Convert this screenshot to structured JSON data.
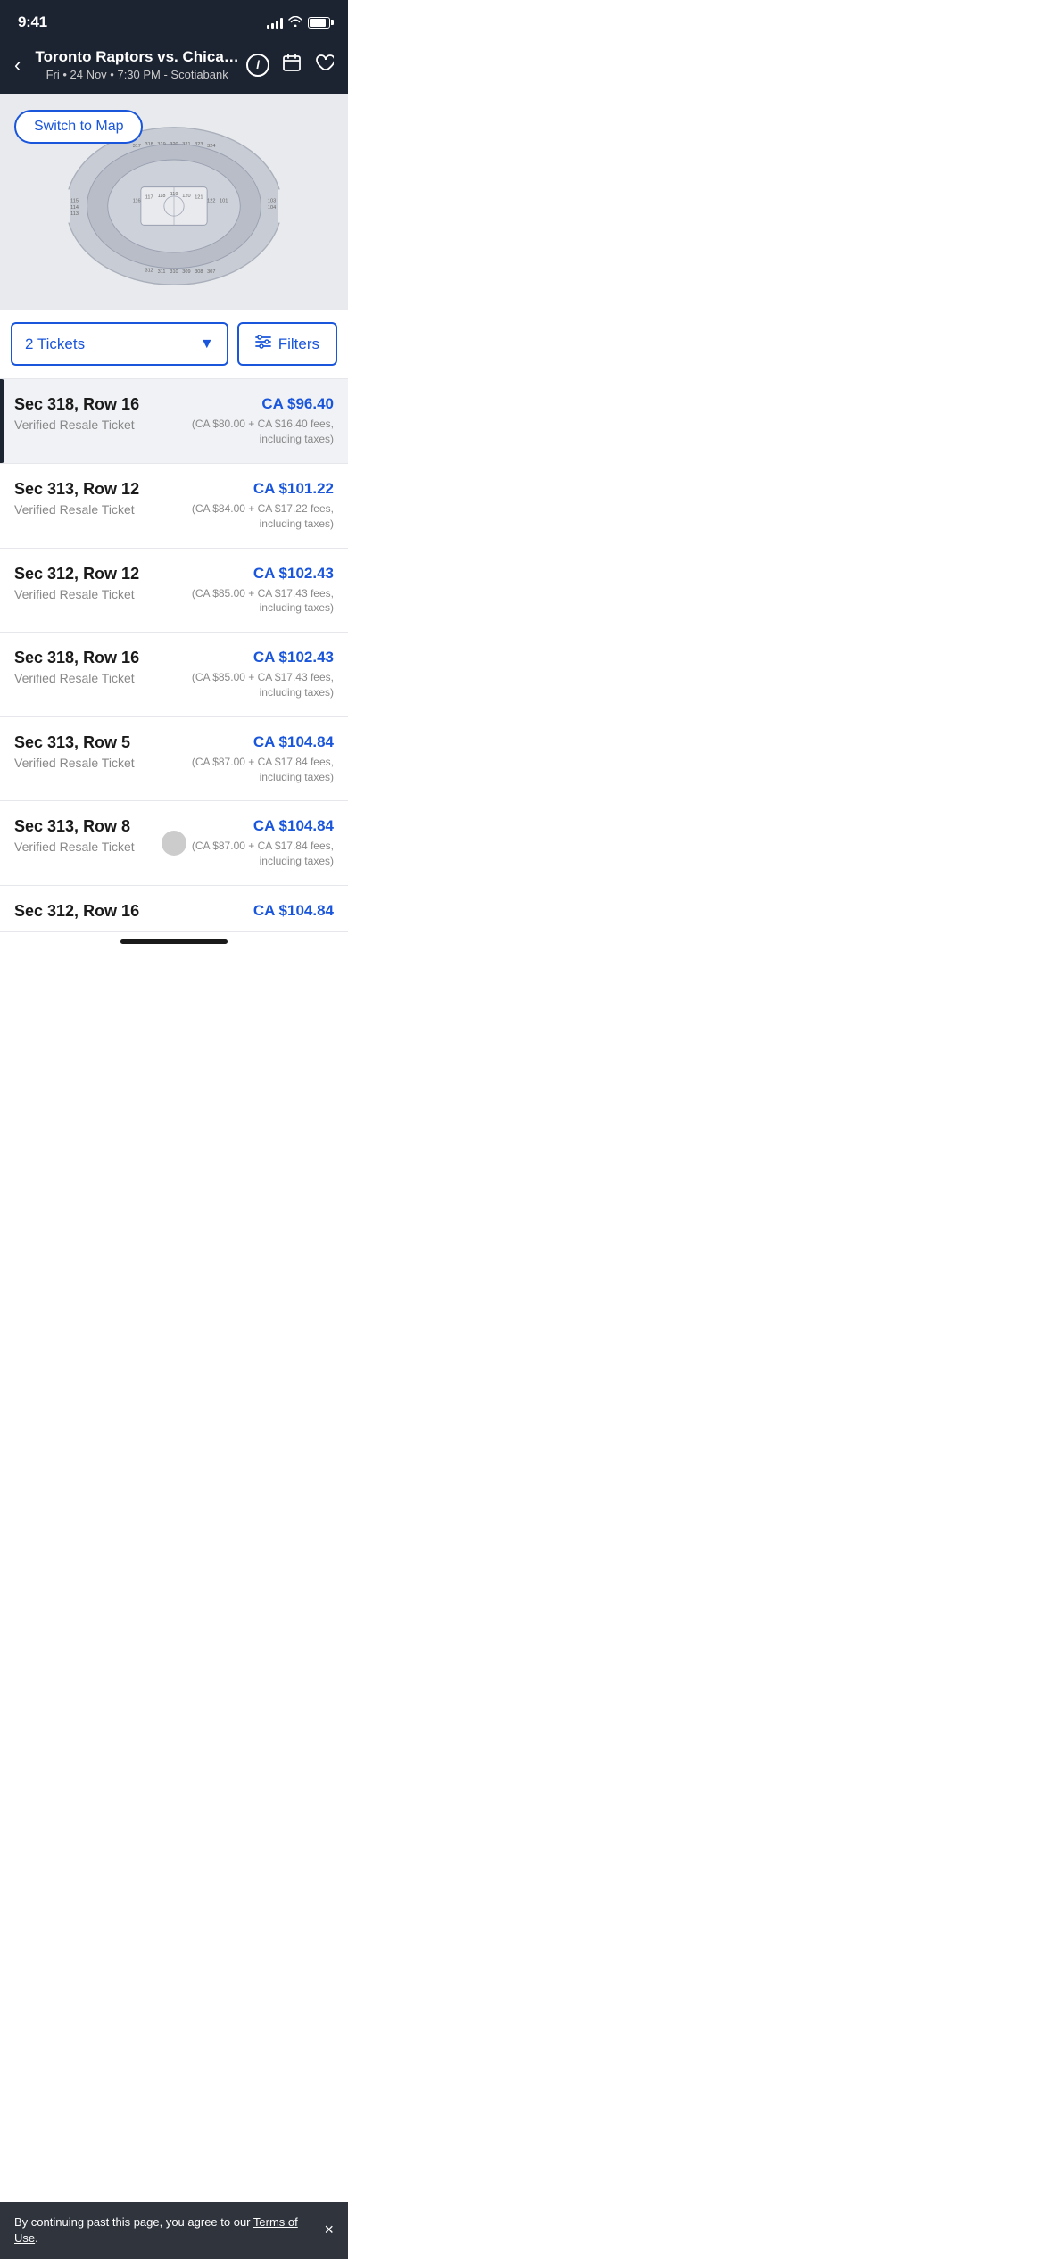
{
  "statusBar": {
    "time": "9:41"
  },
  "header": {
    "title": "Toronto Raptors vs. Chica…",
    "subtitle": "Fri • 24 Nov • 7:30 PM - Scotiabank",
    "backLabel": "‹",
    "infoLabel": "i",
    "calendarLabel": "📅",
    "heartLabel": "♡"
  },
  "venueMap": {
    "switchToMapLabel": "Switch to Map"
  },
  "controls": {
    "ticketsLabel": "2 Tickets",
    "filtersLabel": "Filters"
  },
  "tickets": [
    {
      "section": "Sec 318, Row 16",
      "type": "Verified Resale Ticket",
      "price": "CA $96.40",
      "fees": "(CA $80.00 + CA $16.40 fees, including taxes)",
      "selected": true
    },
    {
      "section": "Sec 313, Row 12",
      "type": "Verified Resale Ticket",
      "price": "CA $101.22",
      "fees": "(CA $84.00 + CA $17.22 fees, including taxes)",
      "selected": false
    },
    {
      "section": "Sec 312, Row 12",
      "type": "Verified Resale Ticket",
      "price": "CA $102.43",
      "fees": "(CA $85.00 + CA $17.43 fees, including taxes)",
      "selected": false
    },
    {
      "section": "Sec 318, Row 16",
      "type": "Verified Resale Ticket",
      "price": "CA $102.43",
      "fees": "(CA $85.00 + CA $17.43 fees, including taxes)",
      "selected": false
    },
    {
      "section": "Sec 313, Row 5",
      "type": "Verified Resale Ticket",
      "price": "CA $104.84",
      "fees": "(CA $87.00 + CA $17.84 fees, including taxes)",
      "selected": false
    },
    {
      "section": "Sec 313, Row 8",
      "type": "Verified Resale Ticket",
      "price": "CA $104.84",
      "fees": "(CA $87.00 + CA $17.84 fees, including taxes)",
      "selected": false,
      "hasBadge": true
    }
  ],
  "partialTicket": {
    "section": "Sec 312, Row 16",
    "price": "CA $104.84"
  },
  "termsBanner": {
    "text": "By continuing past this page, you agree to our ",
    "linkText": "Terms of Use",
    "suffix": ".",
    "closeLabel": "×"
  }
}
